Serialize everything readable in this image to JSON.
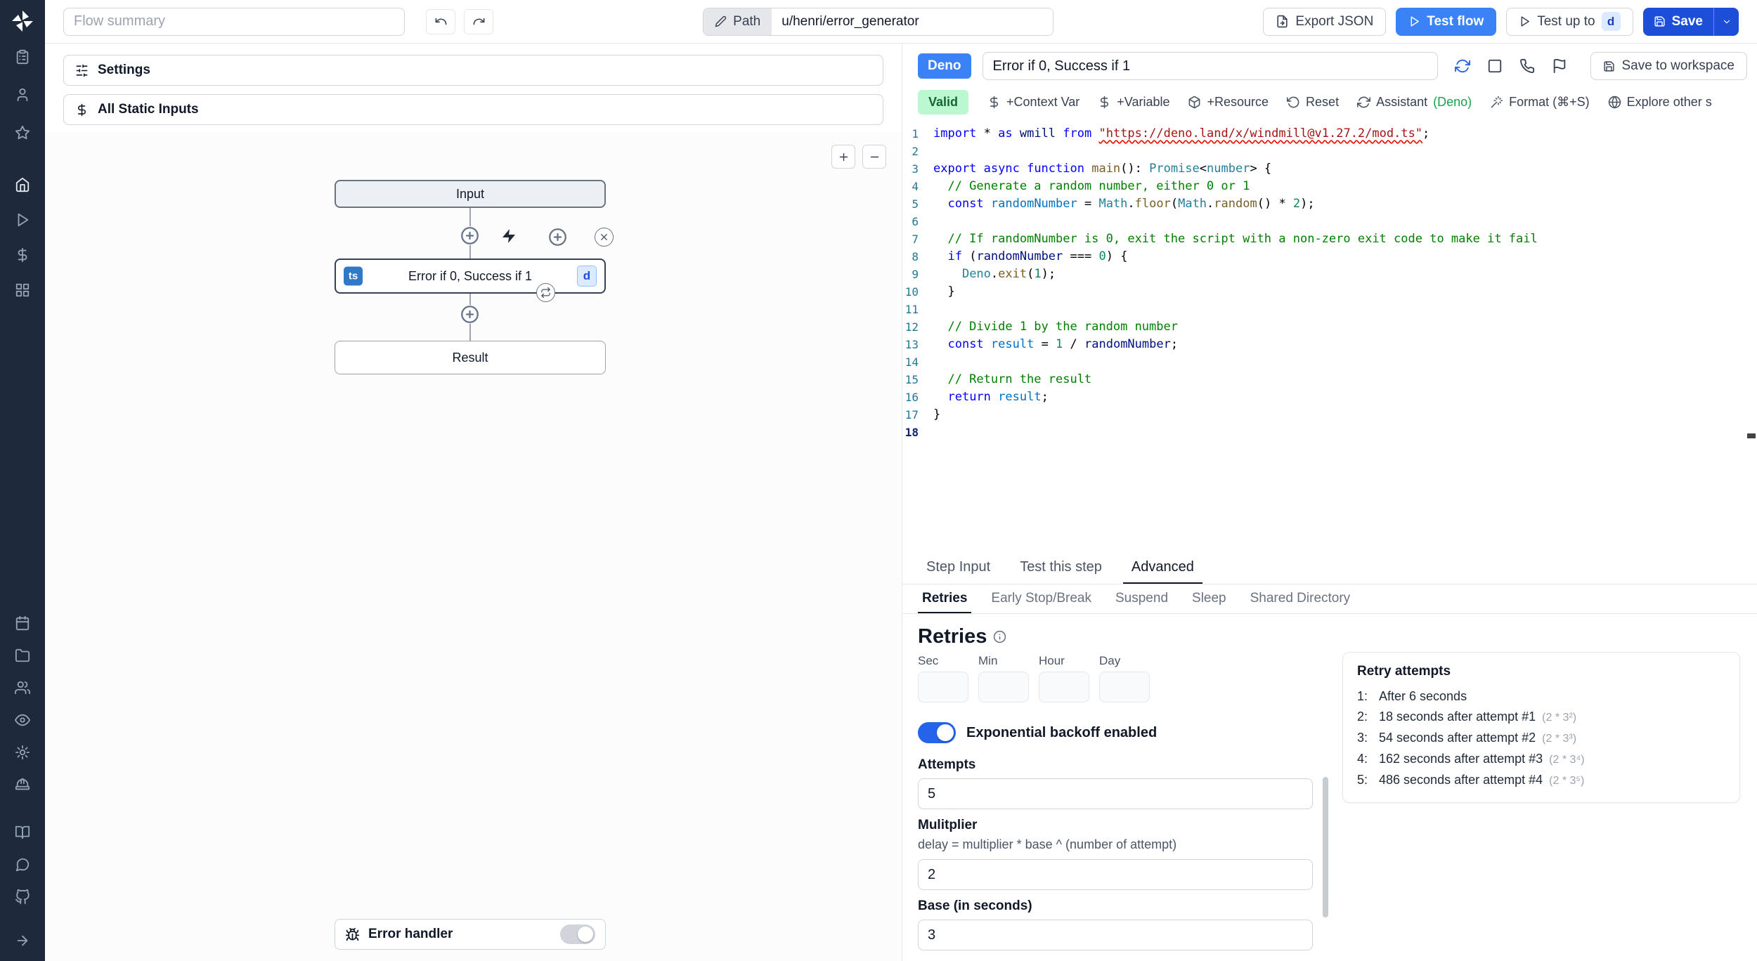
{
  "topbar": {
    "flow_summary_placeholder": "Flow summary",
    "path_label": "Path",
    "path_value": "u/henri/error_generator",
    "export_json_label": "Export JSON",
    "test_flow_label": "Test flow",
    "test_up_to_label": "Test up to",
    "test_up_to_badge": "d",
    "save_label": "Save"
  },
  "sidebar": {
    "icon_groups": [
      [
        "clipboard-list",
        "user",
        "star"
      ],
      [
        "home",
        "play",
        "dollar",
        "grid"
      ],
      [
        "calendar",
        "folder",
        "users",
        "eye",
        "gear",
        "hardhat"
      ],
      [
        "book-open",
        "discord",
        "github"
      ]
    ],
    "expand_icon": "arrow-right"
  },
  "flow": {
    "settings_label": "Settings",
    "static_inputs_label": "All Static Inputs",
    "input_node": "Input",
    "step_node": {
      "lang_badge": "ts",
      "title": "Error if 0, Success if 1",
      "suffix_badge": "d"
    },
    "result_node": "Result",
    "error_handler_label": "Error handler"
  },
  "editor": {
    "lang_badge": "Deno",
    "title": "Error if 0, Success if 1",
    "save_to_workspace_label": "Save to workspace",
    "status_badge": "Valid",
    "toolbar": [
      {
        "icon": "dollar",
        "label": "+Context Var"
      },
      {
        "icon": "dollar",
        "label": "+Variable"
      },
      {
        "icon": "package",
        "label": "+Resource"
      },
      {
        "icon": "rotate-ccw",
        "label": "Reset"
      },
      {
        "icon": "refresh-cw",
        "label": "Assistant",
        "suffix": "(Deno)"
      },
      {
        "icon": "wand",
        "label": "Format (⌘+S)"
      },
      {
        "icon": "globe",
        "label": "Explore other s"
      }
    ],
    "lines": [
      {
        "n": 1,
        "seg": [
          [
            "import ",
            "kw"
          ],
          [
            "* ",
            "pl"
          ],
          [
            "as ",
            "kw"
          ],
          [
            "wmill ",
            "var"
          ],
          [
            "from ",
            "kw"
          ],
          [
            "\"https://deno.land/x/windmill@v1.27.2/mod.ts\"",
            "str sq"
          ],
          [
            ";",
            "pl"
          ]
        ]
      },
      {
        "n": 2,
        "seg": []
      },
      {
        "n": 3,
        "seg": [
          [
            "export ",
            "kw"
          ],
          [
            "async ",
            "kw"
          ],
          [
            "function ",
            "kw"
          ],
          [
            "main",
            "fn"
          ],
          [
            "(): ",
            "pl"
          ],
          [
            "Promise",
            "typ"
          ],
          [
            "<",
            "pl"
          ],
          [
            "number",
            "typ"
          ],
          [
            "> {",
            "pl"
          ]
        ]
      },
      {
        "n": 4,
        "seg": [
          [
            "  // Generate a random number, either 0 or 1",
            "com"
          ]
        ]
      },
      {
        "n": 5,
        "seg": [
          [
            "  ",
            "pl"
          ],
          [
            "const ",
            "kw"
          ],
          [
            "randomNumber",
            "cvar"
          ],
          [
            " = ",
            "pl"
          ],
          [
            "Math",
            "typ"
          ],
          [
            ".",
            "pl"
          ],
          [
            "floor",
            "fn"
          ],
          [
            "(",
            "pl"
          ],
          [
            "Math",
            "typ"
          ],
          [
            ".",
            "pl"
          ],
          [
            "random",
            "fn"
          ],
          [
            "() ",
            "pl"
          ],
          [
            "* ",
            "pl"
          ],
          [
            "2",
            "num"
          ],
          [
            ");",
            "pl"
          ]
        ]
      },
      {
        "n": 6,
        "seg": []
      },
      {
        "n": 7,
        "seg": [
          [
            "  // If randomNumber is 0, exit the script with a non-zero exit code to make it fail",
            "com"
          ]
        ]
      },
      {
        "n": 8,
        "seg": [
          [
            "  ",
            "pl"
          ],
          [
            "if ",
            "kw"
          ],
          [
            "(",
            "pl"
          ],
          [
            "randomNumber",
            "var"
          ],
          [
            " === ",
            "pl"
          ],
          [
            "0",
            "num"
          ],
          [
            ") {",
            "pl"
          ]
        ]
      },
      {
        "n": 9,
        "seg": [
          [
            "    ",
            "pl"
          ],
          [
            "Deno",
            "typ"
          ],
          [
            ".",
            "pl"
          ],
          [
            "exit",
            "fn"
          ],
          [
            "(",
            "pl"
          ],
          [
            "1",
            "num"
          ],
          [
            ");",
            "pl"
          ]
        ]
      },
      {
        "n": 10,
        "seg": [
          [
            "  }",
            "pl"
          ]
        ]
      },
      {
        "n": 11,
        "seg": []
      },
      {
        "n": 12,
        "seg": [
          [
            "  // Divide 1 by the random number",
            "com"
          ]
        ]
      },
      {
        "n": 13,
        "seg": [
          [
            "  ",
            "pl"
          ],
          [
            "const ",
            "kw"
          ],
          [
            "result",
            "cvar"
          ],
          [
            " = ",
            "pl"
          ],
          [
            "1",
            "num"
          ],
          [
            " / ",
            "pl"
          ],
          [
            "randomNumber",
            "var"
          ],
          [
            ";",
            "pl"
          ]
        ]
      },
      {
        "n": 14,
        "seg": []
      },
      {
        "n": 15,
        "seg": [
          [
            "  // Return the result",
            "com"
          ]
        ]
      },
      {
        "n": 16,
        "seg": [
          [
            "  ",
            "pl"
          ],
          [
            "return ",
            "kw"
          ],
          [
            "result",
            "cvar"
          ],
          [
            ";",
            "pl"
          ]
        ]
      },
      {
        "n": 17,
        "seg": [
          [
            "}",
            "pl"
          ]
        ]
      },
      {
        "n": 18,
        "seg": [],
        "active": true
      }
    ]
  },
  "bottom": {
    "tabs": [
      {
        "label": "Step Input",
        "active": false
      },
      {
        "label": "Test this step",
        "active": false
      },
      {
        "label": "Advanced",
        "active": true
      }
    ],
    "subtabs": [
      {
        "label": "Retries",
        "active": true
      },
      {
        "label": "Early Stop/Break",
        "active": false
      },
      {
        "label": "Suspend",
        "active": false
      },
      {
        "label": "Sleep",
        "active": false
      },
      {
        "label": "Shared Directory",
        "active": false
      }
    ],
    "retries": {
      "heading": "Retries",
      "time_fields": [
        "Sec",
        "Min",
        "Hour",
        "Day"
      ],
      "backoff_label": "Exponential backoff enabled",
      "attempts_label": "Attempts",
      "attempts_value": "5",
      "multiplier_label": "Mulitplier",
      "multiplier_help": "delay = multiplier * base ^ (number of attempt)",
      "multiplier_value": "2",
      "base_label": "Base (in seconds)",
      "base_value": "3",
      "retry_box_title": "Retry attempts",
      "retry_items": [
        {
          "num": "1:",
          "text": "After 6 seconds",
          "formula": ""
        },
        {
          "num": "2:",
          "text": "18 seconds after attempt #1",
          "formula": "(2 * 3²)"
        },
        {
          "num": "3:",
          "text": "54 seconds after attempt #2",
          "formula": "(2 * 3³)"
        },
        {
          "num": "4:",
          "text": "162 seconds after attempt #3",
          "formula": "(2 * 3⁴)"
        },
        {
          "num": "5:",
          "text": "486 seconds after attempt #4",
          "formula": "(2 * 3⁵)"
        }
      ]
    }
  },
  "colors": {
    "primary_blue": "#3b82f6",
    "save_blue": "#1d4ed8",
    "sidebar_bg": "#1e293b",
    "valid_green_bg": "#bbf7d0",
    "valid_green_text": "#166534"
  }
}
